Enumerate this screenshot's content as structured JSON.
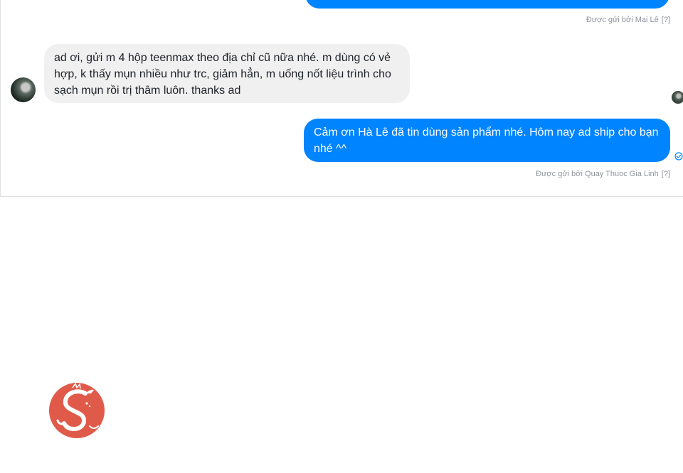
{
  "messages": [
    {
      "direction": "outgoing",
      "sent_by_label": "Được gửi bởi Mai Lê",
      "help": "[?]"
    },
    {
      "direction": "incoming",
      "text": "ad ơi, gửi m 4 hộp teenmax theo địa chỉ cũ nữa nhé. m dùng có vẻ hợp, k thấy mụn nhiều như trc, giảm hẳn, m uống nốt liệu trình cho sạch mụn rồi trị thâm luôn. thanks ad"
    },
    {
      "direction": "outgoing",
      "text": "Cảm ơn Hà Lê đã tin dùng sản phẩm nhé. Hôm nay ad ship cho bạn nhé ^^",
      "sent_by_label": "Được gửi bởi Quay Thuoc Gia Linh",
      "help": "[?]"
    }
  ],
  "colors": {
    "outgoing_bubble": "#0084ff",
    "incoming_bubble": "#f1f0f0",
    "meta_text": "#90949c",
    "logo": "#e05a4a"
  },
  "icons": {
    "seen": "check-circle-icon",
    "logo": "dragon-logo"
  }
}
